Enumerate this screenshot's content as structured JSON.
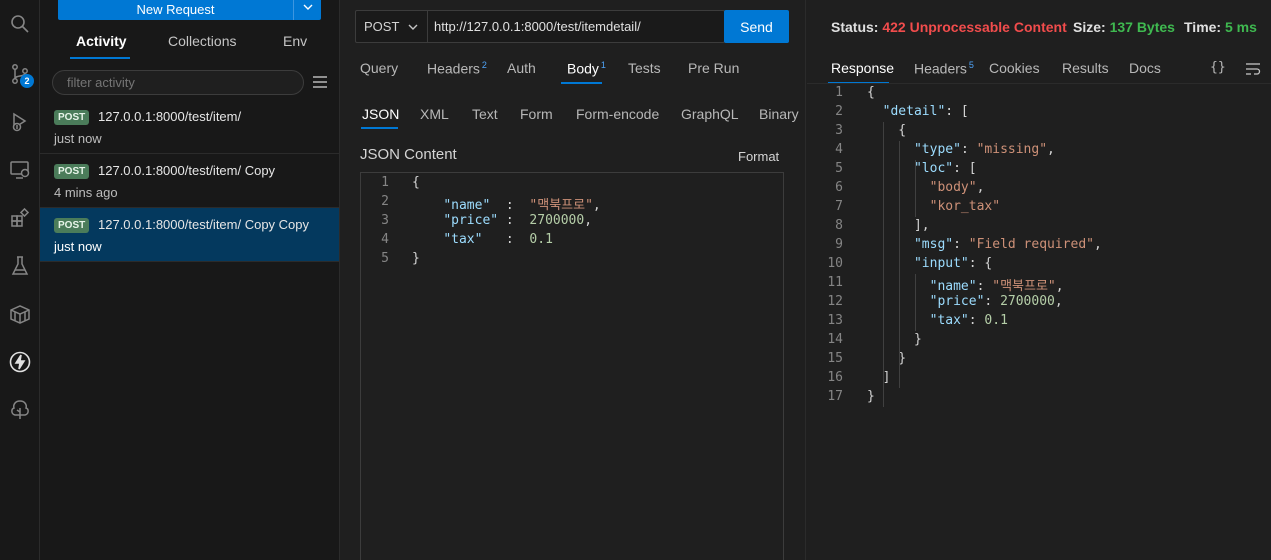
{
  "activity_bar": {
    "icons": [
      "search-icon",
      "source-control-icon",
      "run-debug-icon",
      "remote-explorer-icon",
      "extensions-icon",
      "testing-icon",
      "package-icon",
      "thunder-client-icon",
      "tree-icon"
    ],
    "source_control_badge": "2"
  },
  "sidebar": {
    "new_request": "New Request",
    "tabs": [
      "Activity",
      "Collections",
      "Env"
    ],
    "filter_placeholder": "filter activity",
    "items": [
      {
        "method": "POST",
        "url": "127.0.0.1:8000/test/item/",
        "time": "just now"
      },
      {
        "method": "POST",
        "url": "127.0.0.1:8000/test/item/ Copy",
        "time": "4 mins ago"
      },
      {
        "method": "POST",
        "url": "127.0.0.1:8000/test/item/ Copy Copy",
        "time": "just now"
      }
    ]
  },
  "request": {
    "method": "POST",
    "url": "http://127.0.0.1:8000/test/itemdetail/",
    "send": "Send",
    "tabs": {
      "query": "Query",
      "headers": "Headers",
      "headers_count": "2",
      "auth": "Auth",
      "body": "Body",
      "body_count": "1",
      "tests": "Tests",
      "pre_run": "Pre Run"
    },
    "body_tabs": [
      "JSON",
      "XML",
      "Text",
      "Form",
      "Form-encode",
      "GraphQL",
      "Binary"
    ],
    "json_title": "JSON Content",
    "format": "Format",
    "body_lines": [
      {
        "n": "1",
        "segs": [
          [
            "p",
            "{"
          ]
        ]
      },
      {
        "n": "2",
        "segs": [
          [
            "p",
            "    "
          ],
          [
            "k",
            "\"name\""
          ],
          [
            "p",
            "  :  "
          ],
          [
            "s",
            "\"맥북프로\""
          ],
          [
            "p",
            ","
          ]
        ]
      },
      {
        "n": "3",
        "segs": [
          [
            "p",
            "    "
          ],
          [
            "k",
            "\"price\""
          ],
          [
            "p",
            " :  "
          ],
          [
            "n",
            "2700000"
          ],
          [
            "p",
            ","
          ]
        ]
      },
      {
        "n": "4",
        "segs": [
          [
            "p",
            "    "
          ],
          [
            "k",
            "\"tax\""
          ],
          [
            "p",
            "   :  "
          ],
          [
            "n",
            "0.1"
          ]
        ]
      },
      {
        "n": "5",
        "segs": [
          [
            "p",
            "}"
          ]
        ]
      }
    ]
  },
  "response": {
    "status_label": "Status:",
    "status_value": "422 Unprocessable Content",
    "size_label": "Size:",
    "size_value": "137 Bytes",
    "time_label": "Time:",
    "time_value": "5 ms",
    "status_color": "#f14c4c",
    "ok_color": "#3fb950",
    "tabs": {
      "response": "Response",
      "headers": "Headers",
      "headers_count": "5",
      "cookies": "Cookies",
      "results": "Results",
      "docs": "Docs"
    },
    "lines": [
      {
        "n": "1",
        "segs": [
          [
            "p",
            "{"
          ]
        ]
      },
      {
        "n": "2",
        "segs": [
          [
            "p",
            "  "
          ],
          [
            "k",
            "\"detail\""
          ],
          [
            "p",
            ": ["
          ]
        ]
      },
      {
        "n": "3",
        "segs": [
          [
            "p",
            "    {"
          ]
        ]
      },
      {
        "n": "4",
        "segs": [
          [
            "p",
            "      "
          ],
          [
            "k",
            "\"type\""
          ],
          [
            "p",
            ": "
          ],
          [
            "s",
            "\"missing\""
          ],
          [
            "p",
            ","
          ]
        ]
      },
      {
        "n": "5",
        "segs": [
          [
            "p",
            "      "
          ],
          [
            "k",
            "\"loc\""
          ],
          [
            "p",
            ": ["
          ]
        ]
      },
      {
        "n": "6",
        "segs": [
          [
            "p",
            "        "
          ],
          [
            "s",
            "\"body\""
          ],
          [
            "p",
            ","
          ]
        ]
      },
      {
        "n": "7",
        "segs": [
          [
            "p",
            "        "
          ],
          [
            "s",
            "\"kor_tax\""
          ]
        ]
      },
      {
        "n": "8",
        "segs": [
          [
            "p",
            "      ],"
          ]
        ]
      },
      {
        "n": "9",
        "segs": [
          [
            "p",
            "      "
          ],
          [
            "k",
            "\"msg\""
          ],
          [
            "p",
            ": "
          ],
          [
            "s",
            "\"Field required\""
          ],
          [
            "p",
            ","
          ]
        ]
      },
      {
        "n": "10",
        "segs": [
          [
            "p",
            "      "
          ],
          [
            "k",
            "\"input\""
          ],
          [
            "p",
            ": {"
          ]
        ]
      },
      {
        "n": "11",
        "segs": [
          [
            "p",
            "        "
          ],
          [
            "k",
            "\"name\""
          ],
          [
            "p",
            ": "
          ],
          [
            "s",
            "\"맥북프로\""
          ],
          [
            "p",
            ","
          ]
        ]
      },
      {
        "n": "12",
        "segs": [
          [
            "p",
            "        "
          ],
          [
            "k",
            "\"price\""
          ],
          [
            "p",
            ": "
          ],
          [
            "n",
            "2700000"
          ],
          [
            "p",
            ","
          ]
        ]
      },
      {
        "n": "13",
        "segs": [
          [
            "p",
            "        "
          ],
          [
            "k",
            "\"tax\""
          ],
          [
            "p",
            ": "
          ],
          [
            "n",
            "0.1"
          ]
        ]
      },
      {
        "n": "14",
        "segs": [
          [
            "p",
            "      }"
          ]
        ]
      },
      {
        "n": "15",
        "segs": [
          [
            "p",
            "    }"
          ]
        ]
      },
      {
        "n": "16",
        "segs": [
          [
            "p",
            "  ]"
          ]
        ]
      },
      {
        "n": "17",
        "segs": [
          [
            "p",
            "}"
          ]
        ]
      }
    ]
  }
}
